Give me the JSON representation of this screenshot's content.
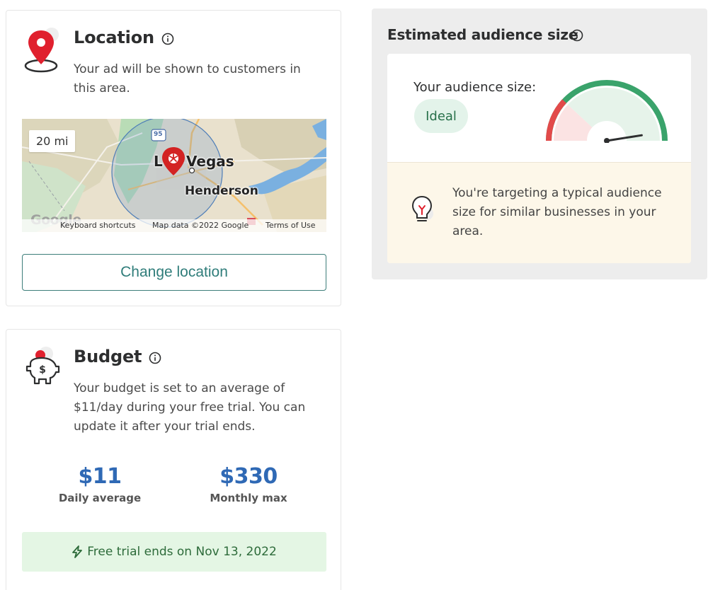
{
  "location": {
    "title": "Location",
    "description": "Your ad will be shown to customers in this area.",
    "map": {
      "scale": "20 mi",
      "places": {
        "city": "Las Vegas",
        "city_prefix": "L",
        "city_suffix": "Vegas",
        "suburb": "Henderson",
        "highway": "95"
      },
      "logo": "Google",
      "footer": {
        "shortcuts": "Keyboard shortcuts",
        "map_data": "Map data ©2022 Google",
        "terms": "Terms of Use"
      }
    },
    "change_button": "Change location"
  },
  "audience": {
    "title": "Estimated audience size",
    "size_label": "Your audience size:",
    "size_value": "Ideal",
    "gauge_level": 0.95,
    "hint": "You're targeting a typical audience size for similar businesses in your area."
  },
  "budget": {
    "title": "Budget",
    "description": "Your budget is set to an average of $11/day during your free trial. You can update it after your trial ends.",
    "daily_value": "$11",
    "daily_label": "Daily average",
    "monthly_value": "$330",
    "monthly_label": "Monthly max",
    "trial_text": "Free trial ends on Nov 13, 2022"
  },
  "colors": {
    "brand_red": "#e0202e",
    "teal": "#2f7d7a",
    "value_blue": "#2f69b5",
    "gauge_green": "#3aa36b",
    "gauge_red": "#e24a4a",
    "trial_green": "#2d6b3a"
  },
  "icons": {
    "location": "map-pin-icon",
    "info": "info-circle-icon",
    "budget": "piggy-bank-icon",
    "bolt": "lightning-icon",
    "bulb": "lightbulb-icon"
  }
}
